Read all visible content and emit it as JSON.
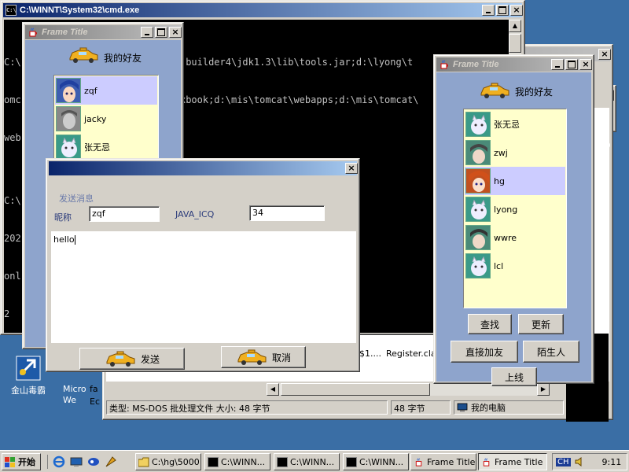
{
  "desktop": {
    "icons": [
      {
        "label": "金山毒霸"
      },
      {
        "label": "Micro We"
      }
    ]
  },
  "cmd": {
    "title": "C:\\WINNT\\System32\\cmd.exe",
    "lines": [
      "C:\\                 ng\\5000;c:\\jbuilder4\\jdk1.3\\lib\\tools.jar;d:\\lyong\\t",
      "omc                  :\\webapps\\xbook;d:\\mis\\tomcat\\webapps;d:\\mis\\tomcat\\",
      "web",
      "",
      "C:\\",
      "202",
      "onl",
      "2"
    ]
  },
  "explorer": {
    "status_type": "类型: MS-DOS 批处理文件 大小: 48 字节",
    "status_size": "48 字节",
    "status_location": "我的电脑",
    "file1": "$1....",
    "file2": "Register.clas",
    "left_fragment_1": "fa",
    "left_fragment_2": "Ec",
    "right_fragment_1": "lyo",
    "right_fragment_2": "om"
  },
  "frame_left": {
    "title": "Frame Title",
    "heading": "我的好友",
    "friends": [
      {
        "name": "zqf",
        "selected": true,
        "avatar_icon": "anime-girl-blue-icon"
      },
      {
        "name": "jacky",
        "selected": false,
        "avatar_icon": "gray-face-icon"
      },
      {
        "name": "张无忌",
        "selected": false,
        "avatar_icon": "cartoon-cat-icon"
      }
    ]
  },
  "frame_right": {
    "title": "Frame Title",
    "heading": "我的好友",
    "friends": [
      {
        "name": "张无忌",
        "selected": false,
        "avatar_icon": "cartoon-cat-icon"
      },
      {
        "name": "zwj",
        "selected": false,
        "avatar_icon": "anime-boy-icon"
      },
      {
        "name": "hg",
        "selected": true,
        "avatar_icon": "anime-redhead-icon"
      },
      {
        "name": "lyong",
        "selected": false,
        "avatar_icon": "cartoon-cat-icon"
      },
      {
        "name": "wwre",
        "selected": false,
        "avatar_icon": "anime-boy-icon"
      },
      {
        "name": "lcl",
        "selected": false,
        "avatar_icon": "cartoon-cat-icon"
      }
    ],
    "buttons": {
      "search": "查找",
      "refresh": "更新",
      "add_direct": "直接加友",
      "stranger": "陌生人",
      "online": "上线"
    }
  },
  "send_dialog": {
    "section_label": "发送消息",
    "nick_label": "昵称",
    "nick_value": "zqf",
    "id_label": "JAVA_ICQ",
    "id_value": "34",
    "message": "hello",
    "send_label": "发送",
    "cancel_label": "取消"
  },
  "taskbar": {
    "start": "开始",
    "tasks": [
      {
        "label": "C:\\hg\\5000",
        "icon": "folder-icon",
        "pressed": false
      },
      {
        "label": "C:\\WINN...",
        "icon": "console-icon",
        "pressed": false
      },
      {
        "label": "C:\\WINN...",
        "icon": "console-icon",
        "pressed": false
      },
      {
        "label": "C:\\WINN...",
        "icon": "console-icon",
        "pressed": false
      },
      {
        "label": "Frame Title",
        "icon": "java-cup-icon",
        "pressed": false
      },
      {
        "label": "Frame Title",
        "icon": "java-cup-icon",
        "pressed": true
      }
    ],
    "ime": "CH",
    "clock": "9:11"
  },
  "colors": {
    "desktop": "#3a6ea5",
    "panel_blue": "#8ea4cc",
    "list_bg": "#ffffcc",
    "selected": "#ccccff",
    "label_navy": "#2a3a7a"
  }
}
